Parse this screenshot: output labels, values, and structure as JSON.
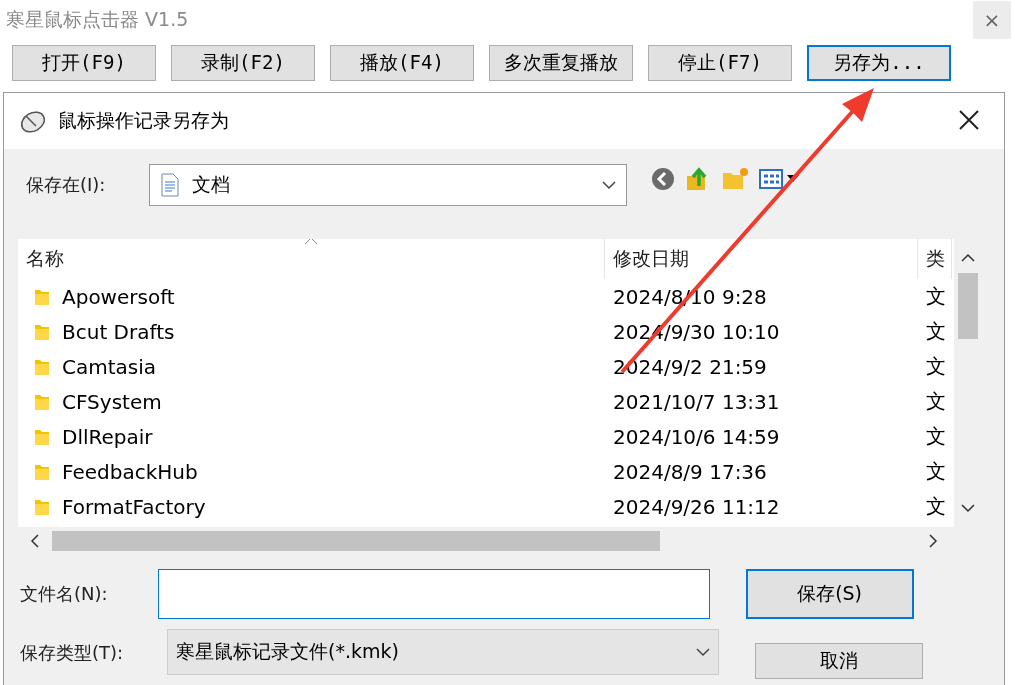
{
  "app": {
    "title": "寒星鼠标点击器 V1.5",
    "close": "×"
  },
  "toolbar": [
    {
      "label": "打开(F9)",
      "focused": false
    },
    {
      "label": "录制(F2)",
      "focused": false
    },
    {
      "label": "播放(F4)",
      "focused": false
    },
    {
      "label": "多次重复播放",
      "focused": false
    },
    {
      "label": "停止(F7)",
      "focused": false
    },
    {
      "label": "另存为...",
      "focused": true
    }
  ],
  "dialog": {
    "title": "鼠标操作记录另存为",
    "save_in": {
      "label": "保存在(I):",
      "value": "文档"
    },
    "columns": [
      {
        "label": "名称",
        "sorted": true
      },
      {
        "label": "修改日期",
        "sorted": false
      },
      {
        "label": "类",
        "sorted": false
      }
    ],
    "rows": [
      {
        "name": "Apowersoft",
        "date": "2024/8/10 9:28",
        "column_3": "文"
      },
      {
        "name": "Bcut Drafts",
        "date": "2024/9/30 10:10",
        "column_3": "文"
      },
      {
        "name": "Camtasia",
        "date": "2024/9/2 21:59",
        "column_3": "文"
      },
      {
        "name": "CFSystem",
        "date": "2021/10/7 13:31",
        "column_3": "文"
      },
      {
        "name": "DllRepair",
        "date": "2024/10/6 14:59",
        "column_3": "文"
      },
      {
        "name": "FeedbackHub",
        "date": "2024/8/9 17:36",
        "column_3": "文"
      },
      {
        "name": "FormatFactory",
        "date": "2024/9/26 11:12",
        "column_3": "文"
      }
    ],
    "filename": {
      "label": "文件名(N):"
    },
    "filetype": {
      "label": "保存类型(T):",
      "value": "寒星鼠标记录文件(*.kmk)"
    },
    "buttons": [
      {
        "label": "保存(S)",
        "default": true
      },
      {
        "label": "取消",
        "default": false
      }
    ]
  },
  "annotation": {
    "kind": "arrow",
    "color": "#f03a2e"
  }
}
